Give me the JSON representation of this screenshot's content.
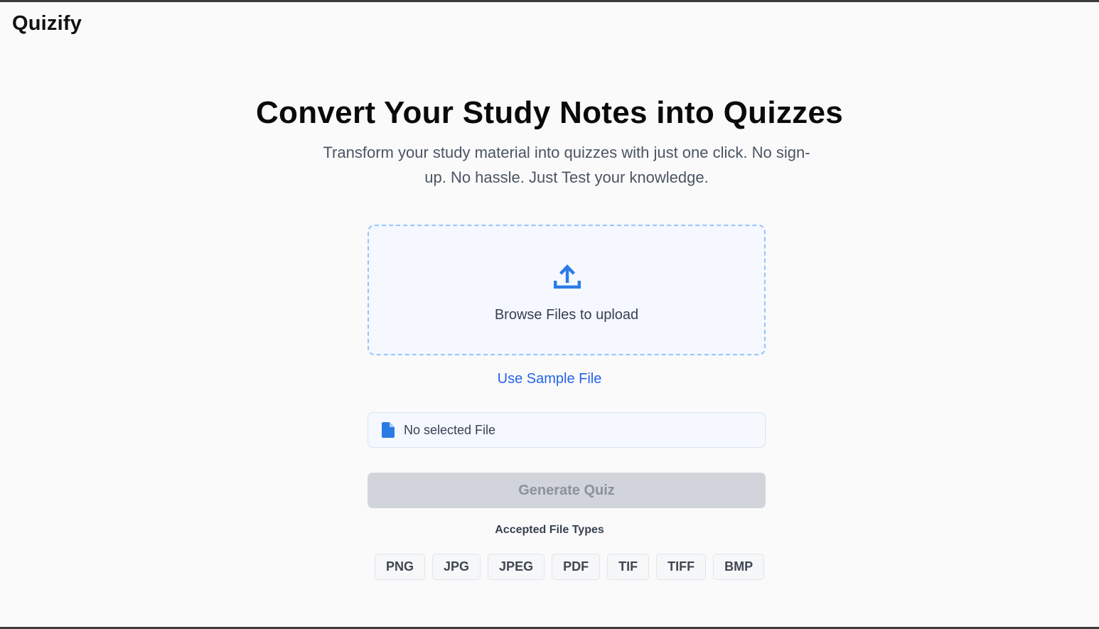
{
  "header": {
    "brand": "Quizify"
  },
  "hero": {
    "title": "Convert Your Study Notes into Quizzes",
    "subtitle": "Transform your study material into quizzes with just one click. No sign-up. No hassle. Just Test your knowledge."
  },
  "upload": {
    "label": "Browse Files to upload",
    "icon": "upload-icon",
    "sample_link": "Use Sample File"
  },
  "file_status": {
    "icon": "file-icon",
    "text": "No selected File"
  },
  "actions": {
    "generate_label": "Generate Quiz"
  },
  "accepted": {
    "label": "Accepted File Types",
    "types": [
      "PNG",
      "JPG",
      "JPEG",
      "PDF",
      "TIF",
      "TIFF",
      "BMP"
    ]
  },
  "colors": {
    "accent": "#2563eb",
    "dropzone_border": "#93c5fd",
    "disabled_button": "#d1d5db"
  }
}
